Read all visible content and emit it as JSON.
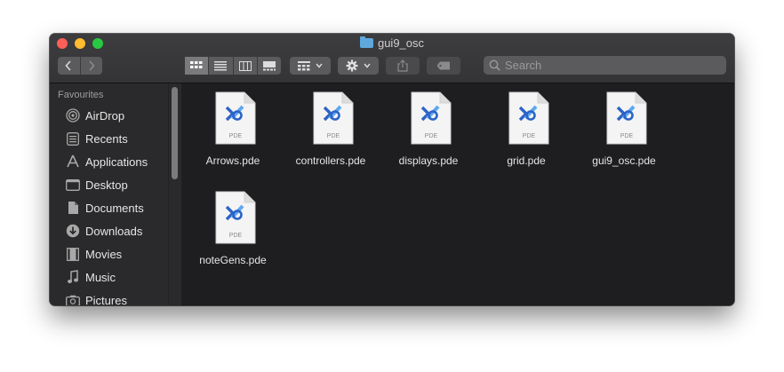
{
  "window": {
    "title": "gui9_osc"
  },
  "toolbar": {
    "search_placeholder": "Search"
  },
  "sidebar": {
    "header": "Favourites",
    "items": [
      {
        "label": "AirDrop",
        "icon": "airdrop-icon"
      },
      {
        "label": "Recents",
        "icon": "recents-icon"
      },
      {
        "label": "Applications",
        "icon": "applications-icon"
      },
      {
        "label": "Desktop",
        "icon": "desktop-icon"
      },
      {
        "label": "Documents",
        "icon": "documents-icon"
      },
      {
        "label": "Downloads",
        "icon": "downloads-icon"
      },
      {
        "label": "Movies",
        "icon": "movies-icon"
      },
      {
        "label": "Music",
        "icon": "music-icon"
      },
      {
        "label": "Pictures",
        "icon": "pictures-icon"
      }
    ]
  },
  "files": [
    {
      "name": "Arrows.pde",
      "type": "PDE"
    },
    {
      "name": "controllers.pde",
      "type": "PDE"
    },
    {
      "name": "displays.pde",
      "type": "PDE"
    },
    {
      "name": "grid.pde",
      "type": "PDE"
    },
    {
      "name": "gui9_osc.pde",
      "type": "PDE"
    },
    {
      "name": "noteGens.pde",
      "type": "PDE"
    }
  ],
  "colors": {
    "window_bg": "#1e1e20",
    "sidebar_bg": "#2a2a2c",
    "processing_blue": "#2c63c7",
    "processing_light_blue": "#5ea8f0"
  }
}
